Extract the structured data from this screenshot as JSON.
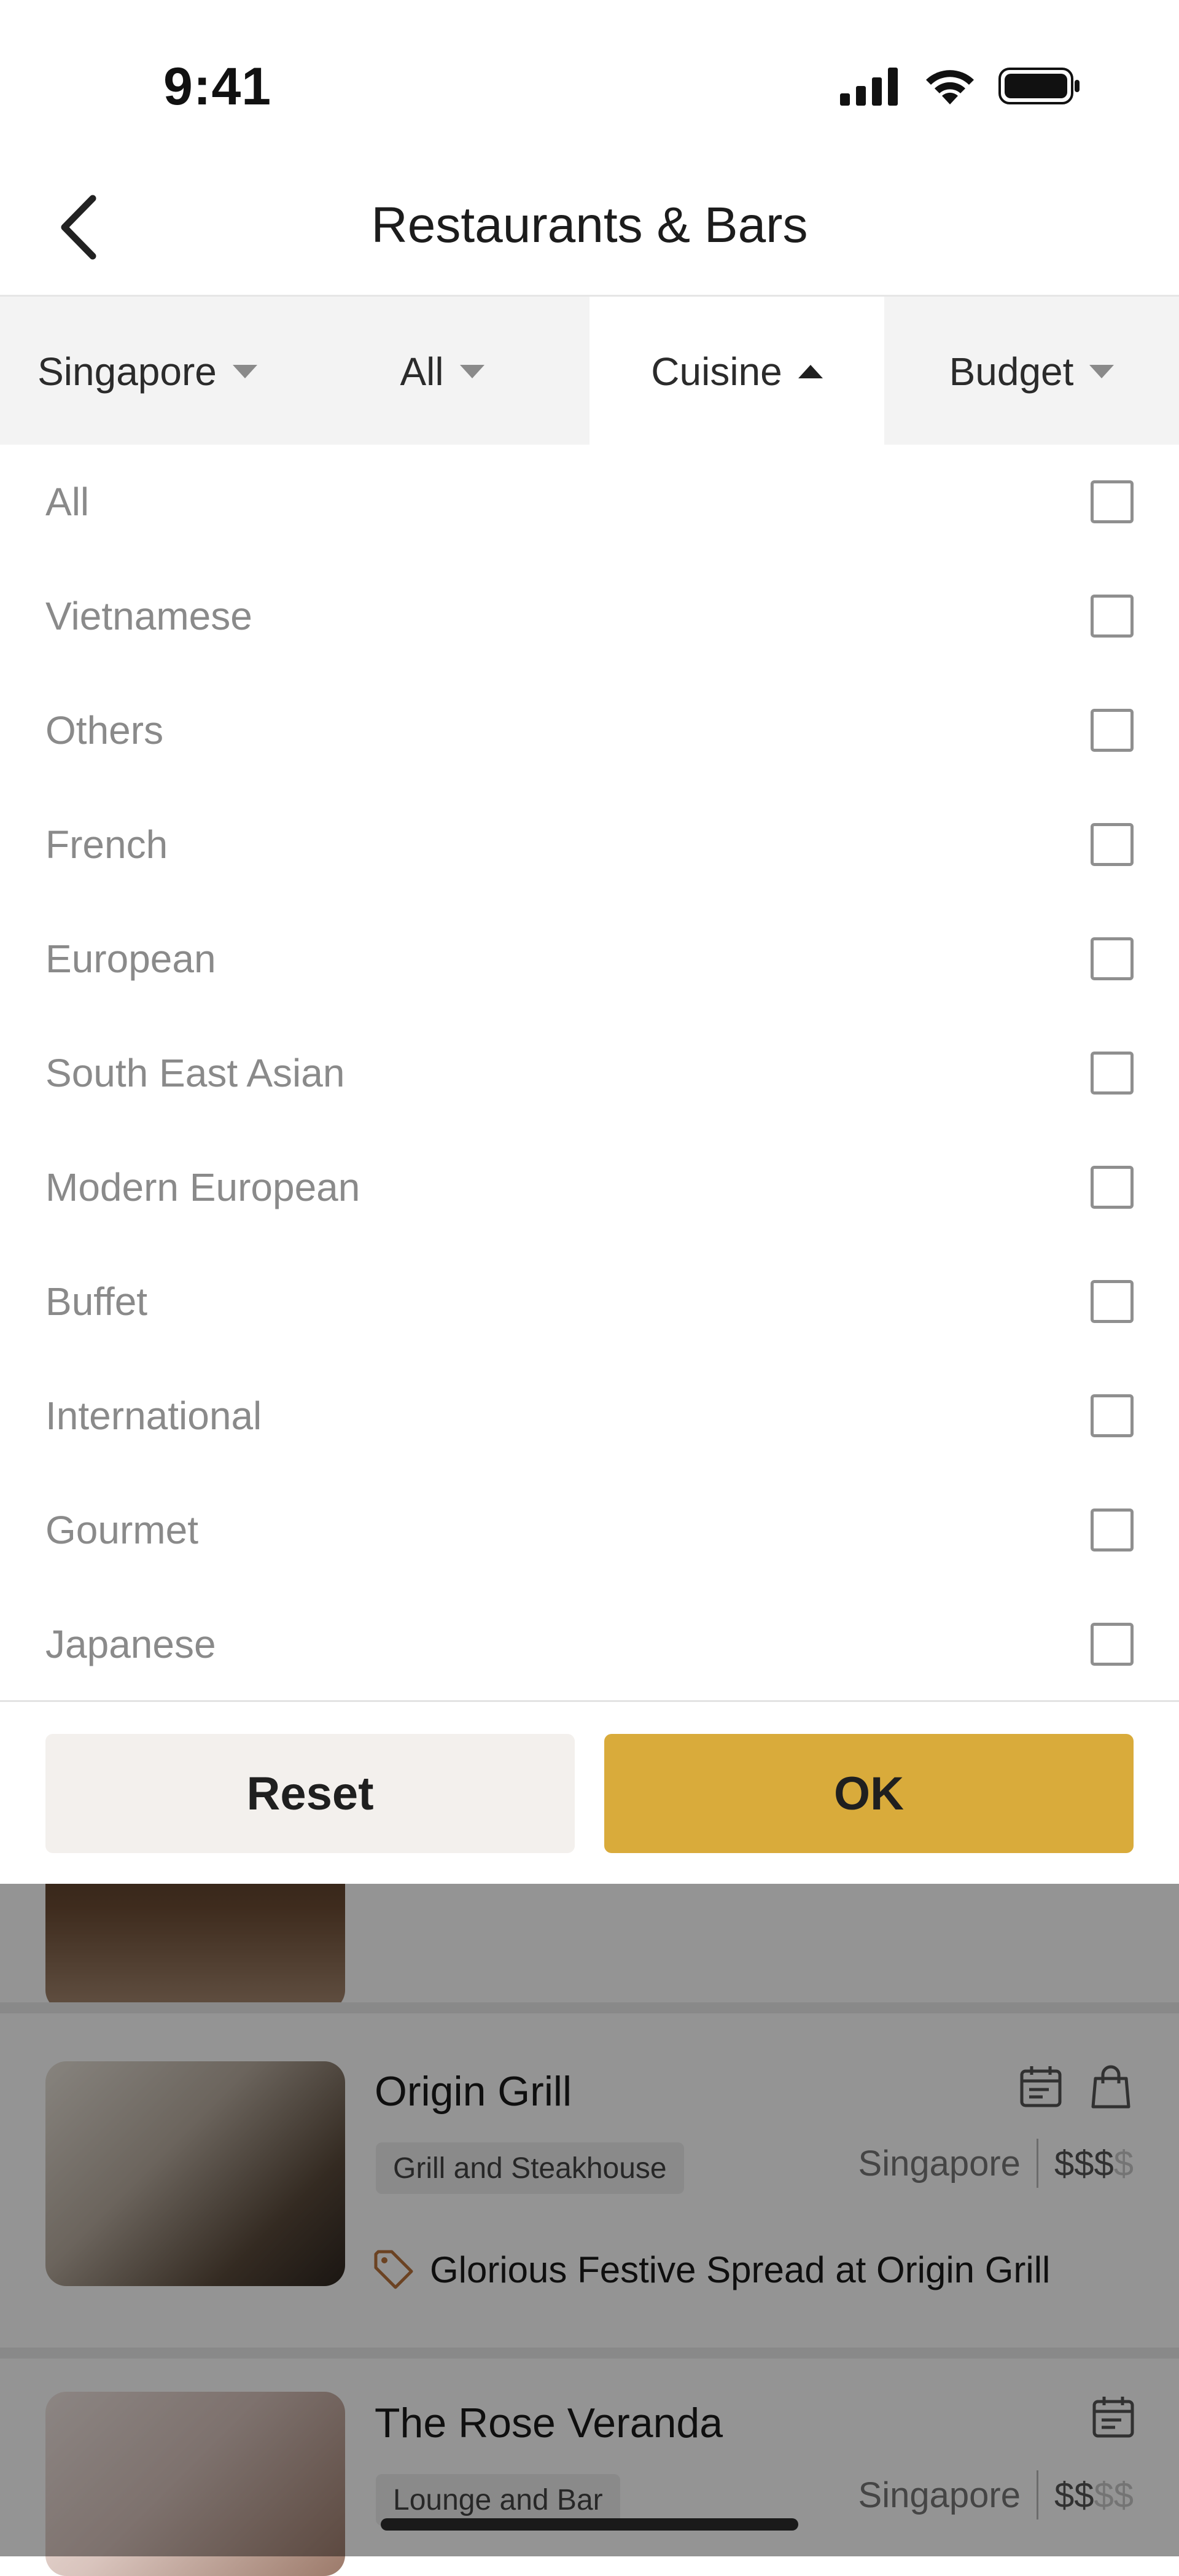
{
  "status_bar": {
    "time": "9:41"
  },
  "header": {
    "title": "Restaurants & Bars"
  },
  "filters": [
    {
      "label": "Singapore",
      "state": "collapsed"
    },
    {
      "label": "All",
      "state": "collapsed"
    },
    {
      "label": "Cuisine",
      "state": "expanded"
    },
    {
      "label": "Budget",
      "state": "collapsed"
    }
  ],
  "cuisine_options": [
    {
      "label": "All",
      "checked": false
    },
    {
      "label": "Vietnamese",
      "checked": false
    },
    {
      "label": "Others",
      "checked": false
    },
    {
      "label": "French",
      "checked": false
    },
    {
      "label": "European",
      "checked": false
    },
    {
      "label": "South East Asian",
      "checked": false
    },
    {
      "label": "Modern European",
      "checked": false
    },
    {
      "label": "Buffet",
      "checked": false
    },
    {
      "label": "International",
      "checked": false
    },
    {
      "label": "Gourmet",
      "checked": false
    },
    {
      "label": "Japanese",
      "checked": false
    }
  ],
  "actions": {
    "reset_label": "Reset",
    "ok_label": "OK"
  },
  "listings": [
    {
      "name": "Origin Grill",
      "tag": "Grill and Steakhouse",
      "location": "Singapore",
      "price_active": "$$$",
      "price_inactive": "$",
      "promo": "Glorious Festive Spread at Origin Grill",
      "icons": [
        "calendar-icon",
        "shopping-bag-icon"
      ]
    },
    {
      "name": "The Rose Veranda",
      "tag": "Lounge and Bar",
      "location": "Singapore",
      "price_active": "$$",
      "price_inactive": "$$",
      "icons": [
        "calendar-icon"
      ]
    }
  ],
  "colors": {
    "accent": "#D9AB3B",
    "reset_bg": "#F3F0ED",
    "filter_bg": "#F3F3F3"
  }
}
